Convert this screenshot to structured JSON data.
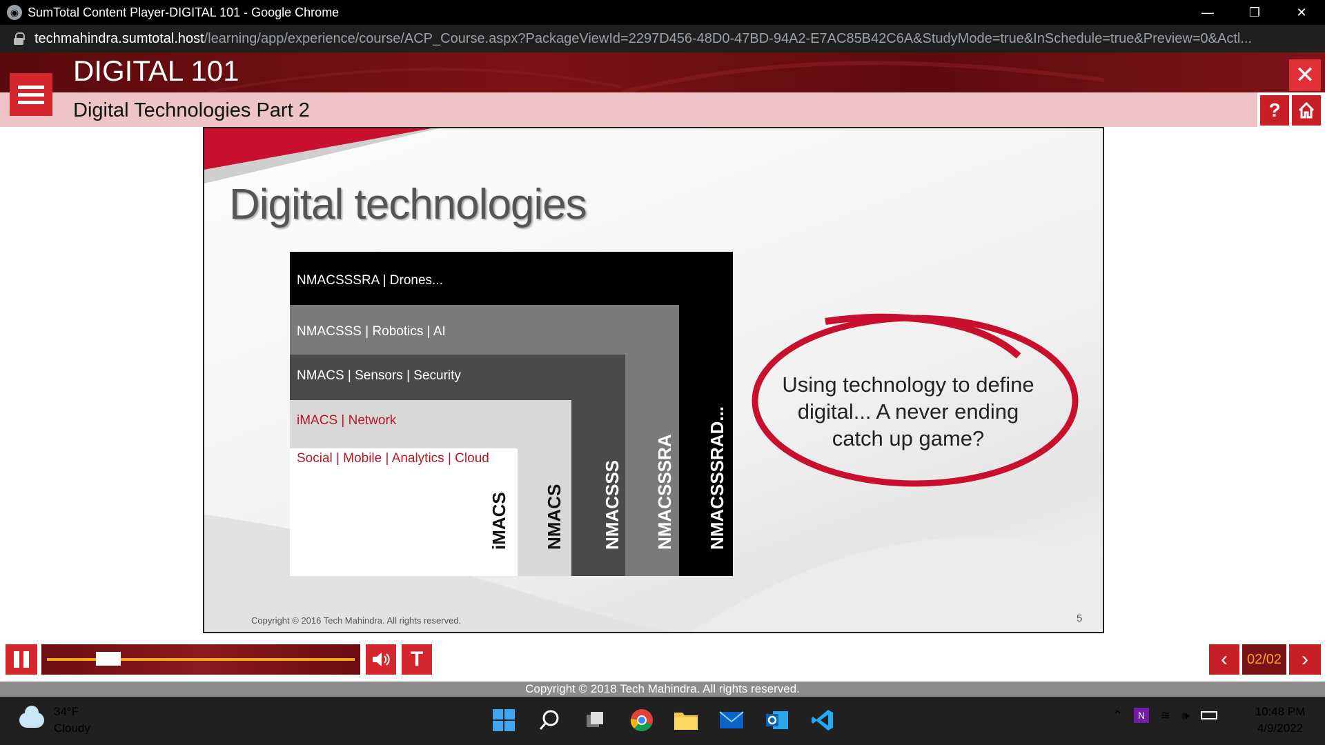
{
  "window": {
    "title": "SumTotal Content Player-DIGITAL 101 - Google Chrome",
    "controls": {
      "minimize": "—",
      "restore": "❐",
      "close": "✕"
    }
  },
  "address_bar": {
    "host": "techmahindra.sumtotal.host",
    "path": "/learning/app/experience/course/ACP_Course.aspx?PackageViewId=2297D456-48D0-47BD-94A2-E7AC85B42C6A&StudyMode=true&InSchedule=true&Preview=0&Actl..."
  },
  "player": {
    "course_title": "DIGITAL 101",
    "module_title": "Digital Technologies Part 2",
    "help_label": "?",
    "close_label": "✕",
    "page_indicator": "02/02",
    "progress_fraction": 0.1,
    "text_button_label": "T",
    "prev_label": "‹",
    "next_label": "›",
    "copyright": "Copyright © 2018 Tech Mahindra. All rights reserved."
  },
  "slide": {
    "heading": "Digital technologies",
    "layers": [
      {
        "label": "NMACSSSRA | Drones...",
        "vertical": "NMACSSSRAD...",
        "color": "#000000",
        "text_color": "#ffffff"
      },
      {
        "label": "NMACSSS | Robotics | AI",
        "vertical": "NMACSSSRA",
        "color": "#7a7a7a",
        "text_color": "#ffffff"
      },
      {
        "label": "NMACS | Sensors | Security",
        "vertical": "NMACSSS",
        "color": "#4a4a4a",
        "text_color": "#ffffff"
      },
      {
        "label": "iMACS | Network",
        "vertical": "NMACS",
        "color": "#d8d8d8",
        "text_color": "#b5172a"
      },
      {
        "label": "Social | Mobile | Analytics | Cloud",
        "vertical": "iMACS",
        "color": "#ffffff",
        "text_color": "#b5172a"
      }
    ],
    "callout": "Using technology to define digital... A never ending catch up game?",
    "copyright": "Copyright © 2016 Tech Mahindra. All rights reserved.",
    "page_number": "5",
    "accent_color": "#c8102e"
  },
  "taskbar": {
    "weather_temp": "34°F",
    "weather_desc": "Cloudy",
    "time": "10:48 PM",
    "date": "4/9/2022"
  }
}
